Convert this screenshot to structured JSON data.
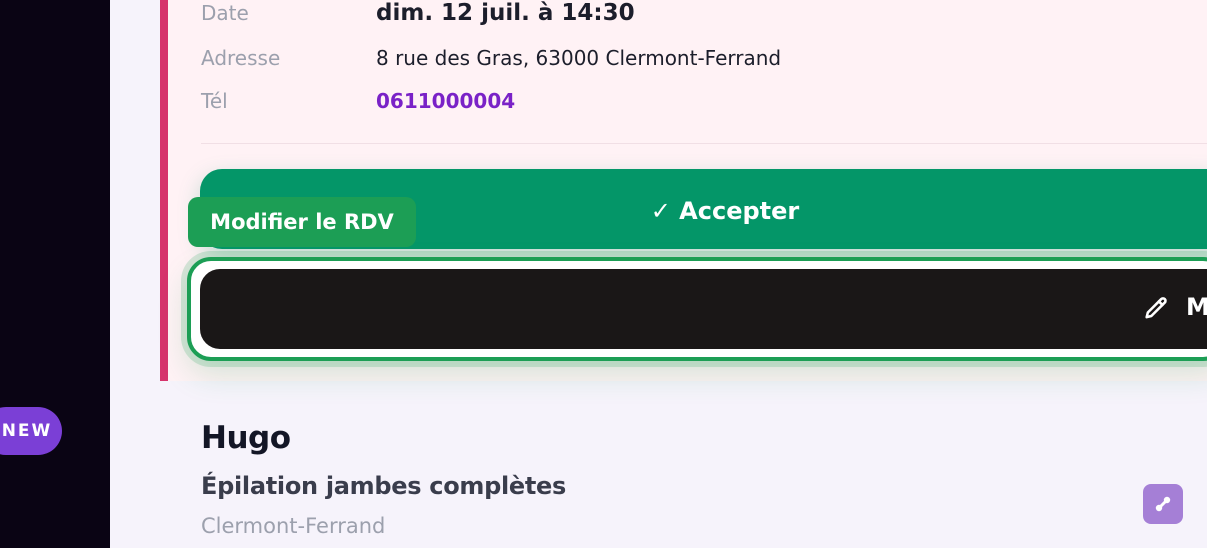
{
  "sidebar": {
    "new_badge": "NEW"
  },
  "details": {
    "date_label": "Date",
    "date_value": "dim. 12 juil. à 14:30",
    "address_label": "Adresse",
    "address_value": "8 rue des Gras, 63000 Clermont-Ferrand",
    "phone_label": "Tél",
    "phone_value": "0611000004"
  },
  "actions": {
    "accept_label": "✓ Accepter",
    "tooltip": "Modifier le RDV",
    "modify_label": "M"
  },
  "next_booking": {
    "name": "Hugo",
    "service": "Épilation jambes complètes",
    "city": "Clermont-Ferrand"
  },
  "colors": {
    "accent_bar": "#d6336c",
    "accept": "#049668",
    "tooltip": "#1c9e55",
    "phone": "#7a22c7"
  },
  "icons": {
    "modify": "pencil-icon",
    "link": "link-icon"
  }
}
